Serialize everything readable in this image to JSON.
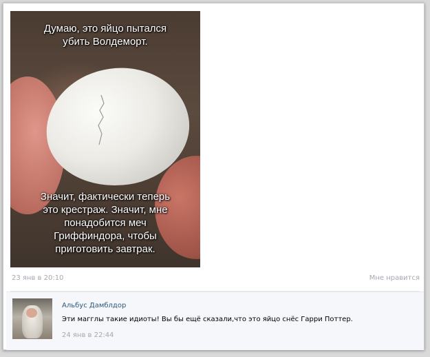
{
  "post": {
    "image_caption_top": "Думаю, это яйцо пытался\nубить Волдеморт.",
    "image_caption_bottom": "Значит, фактически теперь\nэто крестраж. Значит, мне\nпонадобится меч\nГриффиндора, чтобы\nприготовить завтрак.",
    "date": "23 янв в 20:10",
    "like_label": "Мне нравится"
  },
  "comment": {
    "author": "Альбус Дамблдор",
    "text": "Эти магглы такие идиоты! Вы бы ещё сказали,что это яйцо снёс Гарри Поттер.",
    "date": "24 янв в 22:44"
  },
  "colors": {
    "link": "#2b587a",
    "meta": "#a3a8b0",
    "comment_bg": "#f5f7fa"
  }
}
